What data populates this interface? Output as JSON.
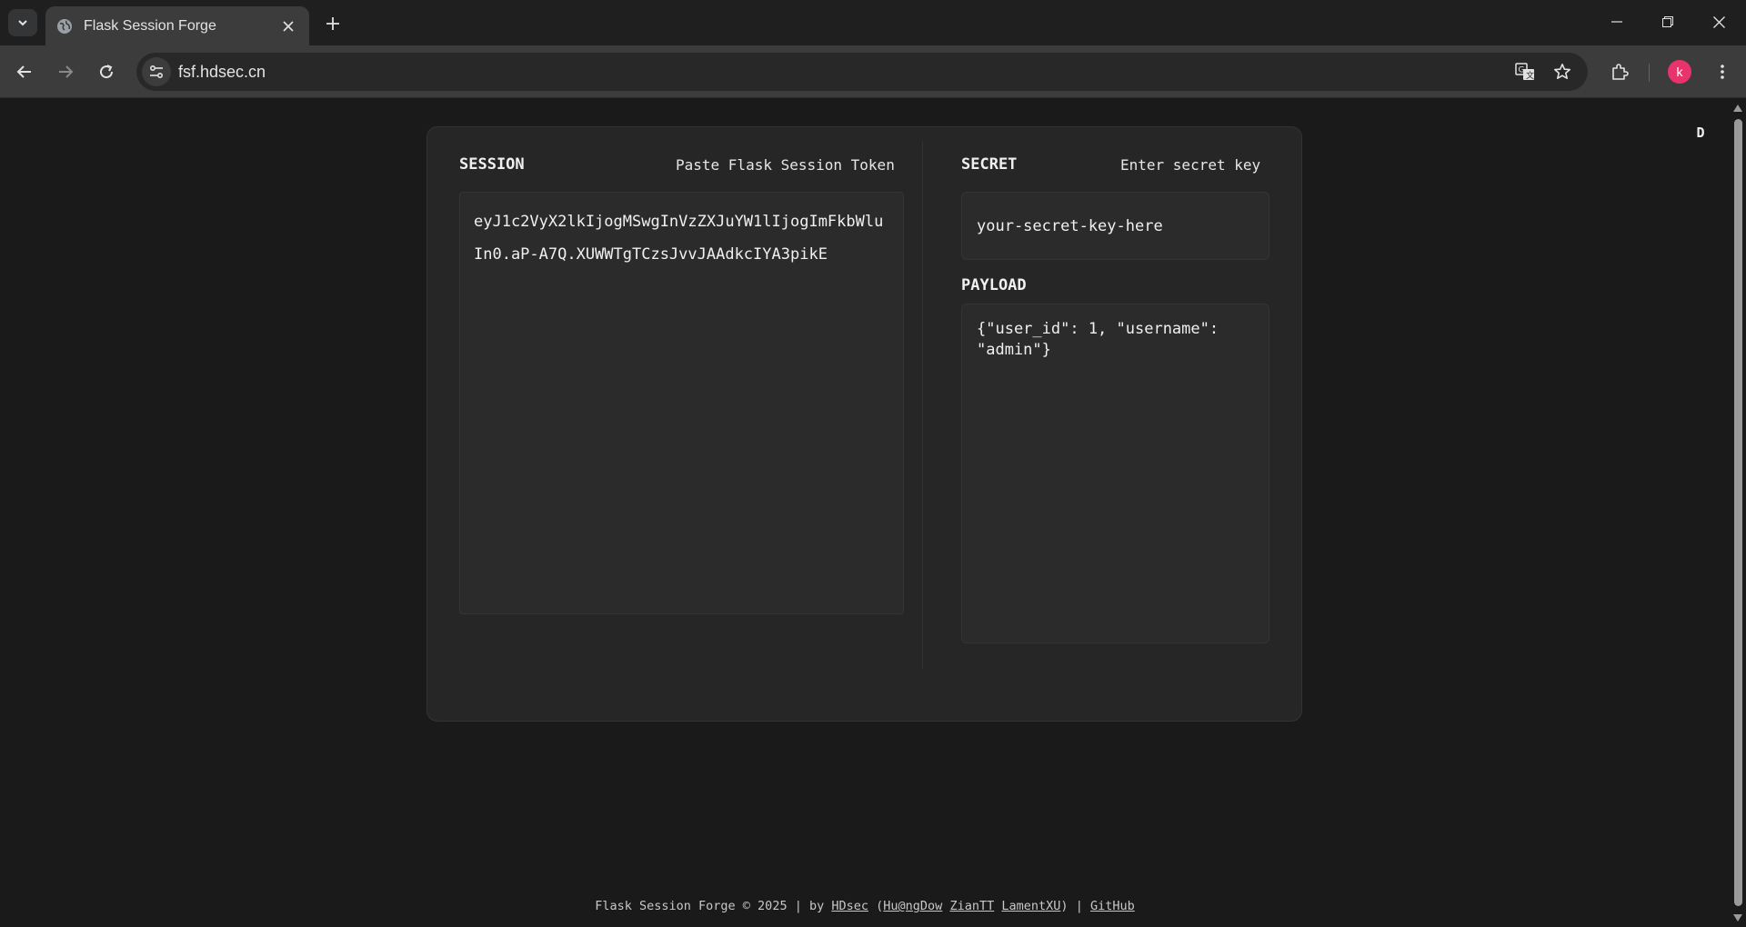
{
  "browser": {
    "tab_title": "Flask Session Forge",
    "url": "fsf.hdsec.cn",
    "profile_initial": "k",
    "colors": {
      "profile_avatar": "#e8336d"
    }
  },
  "page": {
    "theme_toggle": "D",
    "session": {
      "label": "SESSION",
      "hint": "Paste Flask Session Token",
      "value": "eyJ1c2VyX2lkIjogMSwgInVzZXJuYW1lIjogImFkbWluIn0.aP-A7Q.XUWWTgTCzsJvvJAAdkcIYA3pikE"
    },
    "secret": {
      "label": "SECRET",
      "hint": "Enter secret key",
      "value": "your-secret-key-here"
    },
    "payload": {
      "label": "PAYLOAD",
      "value": "{\"user_id\": 1, \"username\": \"admin\"}"
    },
    "footer": {
      "prefix": "Flask Session Forge © 2025 | by",
      "org": "HDsec",
      "open_paren": "(",
      "author1": "Hu@ngDow",
      "author2": "ZianTT",
      "author3": "LamentXU",
      "close_paren": ")",
      "separator": "|",
      "github": "GitHub"
    }
  }
}
